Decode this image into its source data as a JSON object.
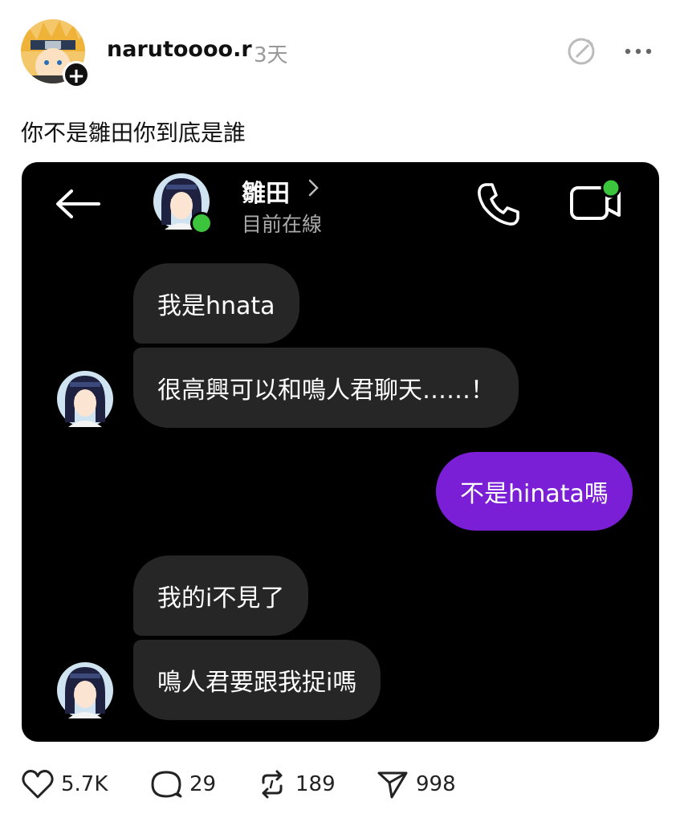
{
  "post": {
    "username": "narutoooo.r",
    "time": "3天",
    "caption": "你不是雛田你到底是誰"
  },
  "chat": {
    "contact_name": "雛田",
    "contact_status": "目前在線",
    "messages": [
      {
        "text": "我是hnata"
      },
      {
        "text": "很高興可以和鳴人君聊天……！"
      },
      {
        "text": "不是hinata嗎"
      },
      {
        "text": "我的i不見了"
      },
      {
        "text": "鳴人君要跟我捉i嗎"
      }
    ]
  },
  "actions": {
    "likes": "5.7K",
    "comments": "29",
    "reposts": "189",
    "shares": "998"
  },
  "colors": {
    "outgoing_bubble": "#7a1fd6",
    "incoming_bubble": "#262626",
    "online": "#3dc43d"
  }
}
